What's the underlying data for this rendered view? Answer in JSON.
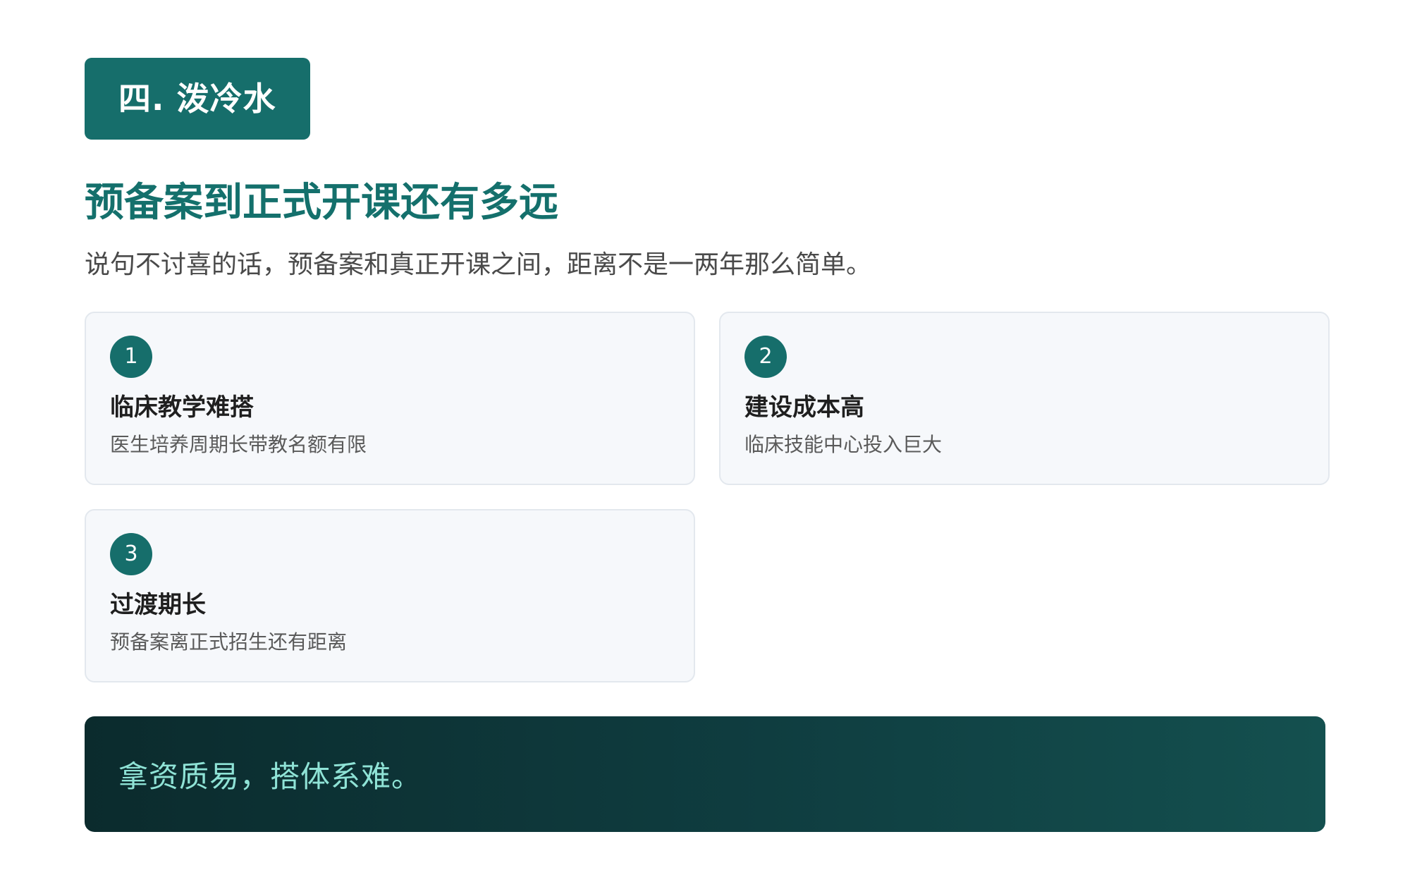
{
  "section": {
    "badge_label": "四. 泼冷水"
  },
  "header": {
    "title": "预备案到正式开课还有多远",
    "subtitle": "说句不讨喜的话，预备案和真正开课之间，距离不是一两年那么简单。"
  },
  "cards": [
    {
      "number": "1",
      "title": "临床教学难搭",
      "desc": "医生培养周期长带教名额有限"
    },
    {
      "number": "2",
      "title": "建设成本高",
      "desc": "临床技能中心投入巨大"
    },
    {
      "number": "3",
      "title": "过渡期长",
      "desc": "预备案离正式招生还有距离"
    }
  ],
  "quote": {
    "text": "拿资质易，搭体系难。"
  },
  "colors": {
    "accent": "#166e6b",
    "title": "#14706c",
    "quote_text": "#8fe3d6",
    "quote_bg_start": "#0b2b2d",
    "quote_bg_end": "#14504f"
  }
}
